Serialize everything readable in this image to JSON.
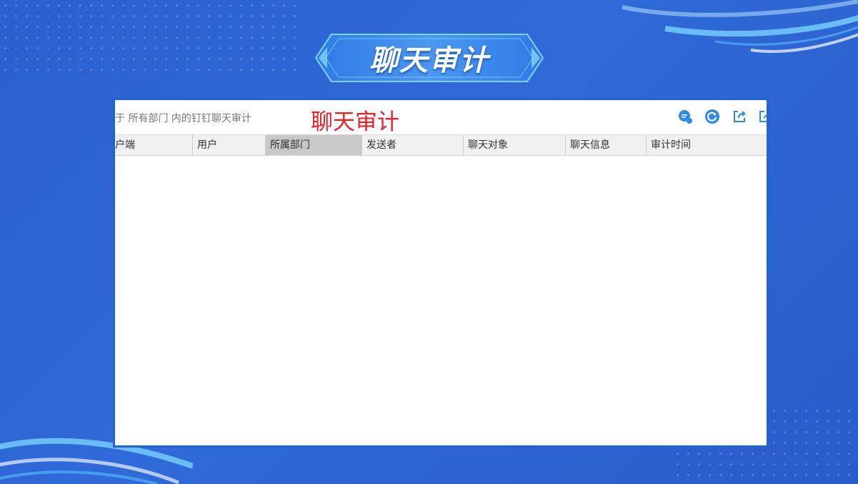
{
  "slide": {
    "title": "聊天审计"
  },
  "panel": {
    "description": "于 所有部门 内的钉钉聊天审计",
    "caption": "聊天审计",
    "toolbar_icons": [
      "chat-bubble-icon",
      "refresh-icon",
      "export-icon",
      "external-link-icon"
    ],
    "columns": [
      {
        "label": "户端"
      },
      {
        "label": "用户"
      },
      {
        "label": "所属部门"
      },
      {
        "label": "发送者"
      },
      {
        "label": "聊天对象"
      },
      {
        "label": "聊天信息"
      },
      {
        "label": "审计时间"
      }
    ],
    "rows": []
  },
  "colors": {
    "background": "#2f6ad8",
    "panel_border": "#1e64d6",
    "caption": "#e8222a",
    "icon": "#2b8ae6"
  }
}
